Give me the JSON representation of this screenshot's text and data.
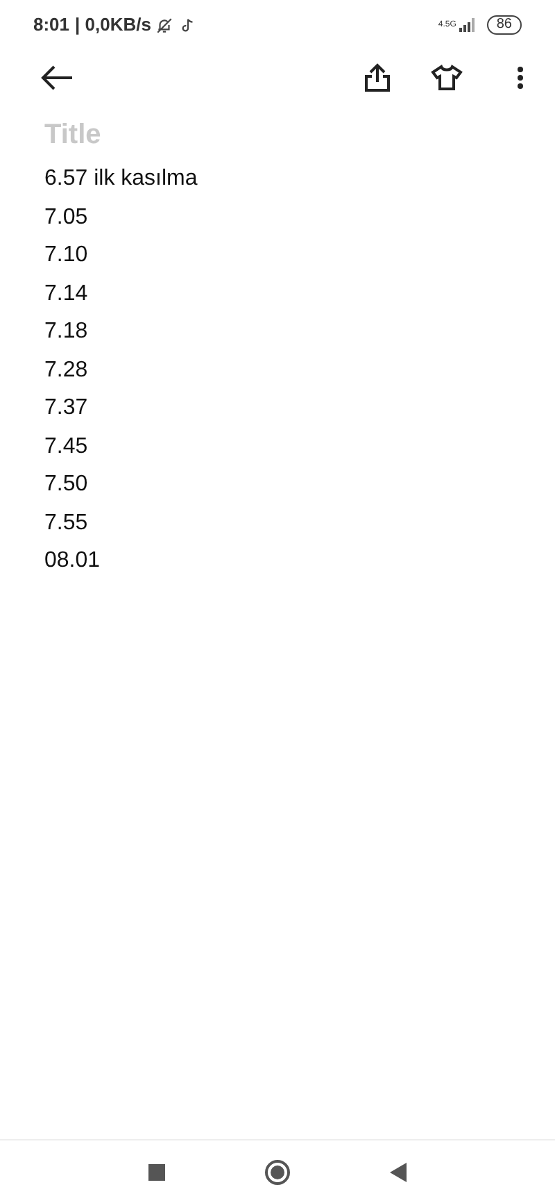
{
  "status_bar": {
    "time": "8:01",
    "speed": "| 0,0KB/s",
    "network": "4.5G",
    "battery": "86"
  },
  "title_field": {
    "placeholder": "Title"
  },
  "lines": [
    "6.57 ilk kasılma",
    "7.05",
    "7.10",
    "7.14",
    "7.18",
    "7.28",
    "7.37",
    "7.45",
    "7.50",
    "7.55",
    "08.01"
  ]
}
